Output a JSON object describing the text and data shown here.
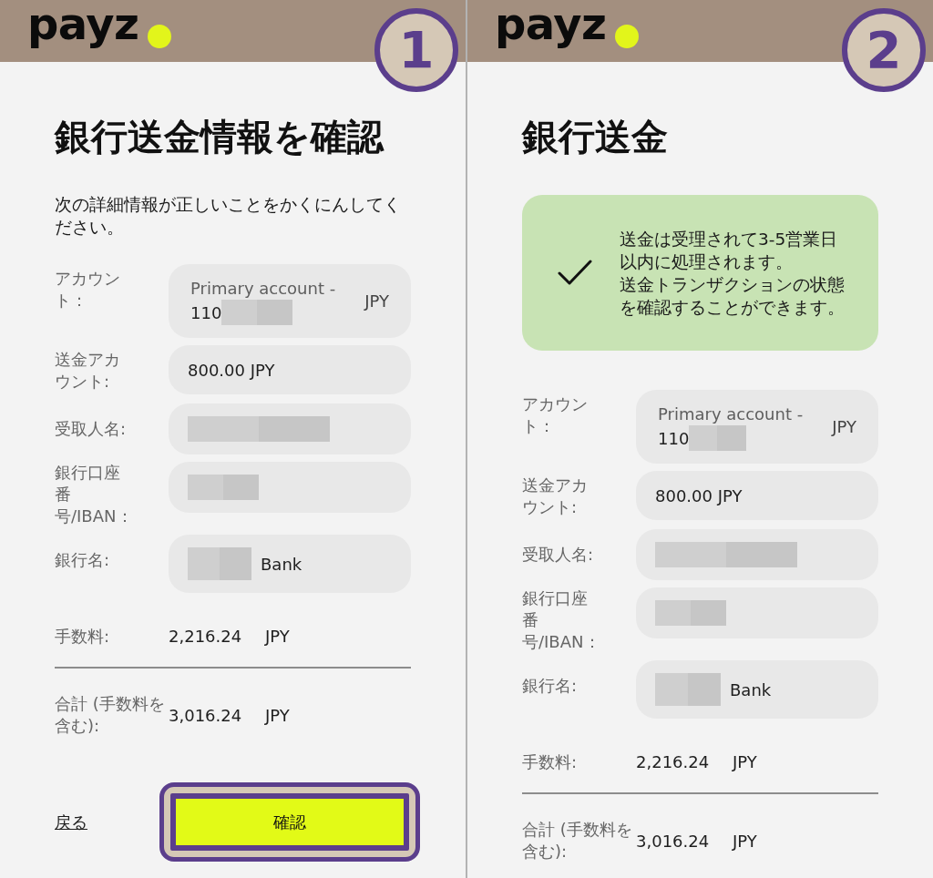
{
  "panels": [
    {
      "header": {
        "logo": "payz"
      },
      "step_badge": "1",
      "title": "銀行送金情報を確認",
      "description": "次の詳細情報が正しいことをかくにんしてください。",
      "fields": [
        {
          "label": "アカウント：",
          "kind": "suffix",
          "value": "Primary account -",
          "number": "110",
          "currency": "JPY",
          "muted": true
        },
        {
          "label": "送金アカウント:",
          "kind": "plain",
          "value": "800.00 JPY",
          "muted": false
        },
        {
          "label": "受取人名:",
          "kind": "masked"
        },
        {
          "label": "銀行口座番号/IBAN：",
          "kind": "masked"
        },
        {
          "label": "銀行名:",
          "kind": "prefix",
          "value": "Bank",
          "muted": false
        }
      ],
      "summary": [
        {
          "label": "手数料:",
          "amount": "2,216.24",
          "currency": "JPY"
        },
        {
          "label": "合計 (手数料を含む):",
          "amount": "3,016.24",
          "currency": "JPY"
        }
      ],
      "actions": {
        "back_link": "戻る",
        "confirm_button": {
          "label": "確認",
          "highlighted": true
        }
      }
    },
    {
      "header": {
        "logo": "payz"
      },
      "step_badge": "2",
      "title": "銀行送金",
      "notice": {
        "kind": "success",
        "messages": [
          "送金は受理されて3-5営業日以内に処理されます。",
          "送金トランザクションの状態を確認することができます。"
        ]
      },
      "fields": [
        {
          "label": "アカウント：",
          "kind": "suffix",
          "value": "Primary account -",
          "number": "110",
          "currency": "JPY",
          "muted": true
        },
        {
          "label": "送金アカウント:",
          "kind": "plain",
          "value": "800.00 JPY",
          "muted": false
        },
        {
          "label": "受取人名:",
          "kind": "masked"
        },
        {
          "label": "銀行口座番号/IBAN：",
          "kind": "masked"
        },
        {
          "label": "銀行名:",
          "kind": "prefix",
          "value": "Bank",
          "muted": false
        }
      ],
      "summary": [
        {
          "label": "手数料:",
          "amount": "2,216.24",
          "currency": "JPY"
        },
        {
          "label": "合計 (手数料を含む):",
          "amount": "3,016.24",
          "currency": "JPY"
        }
      ]
    }
  ]
}
